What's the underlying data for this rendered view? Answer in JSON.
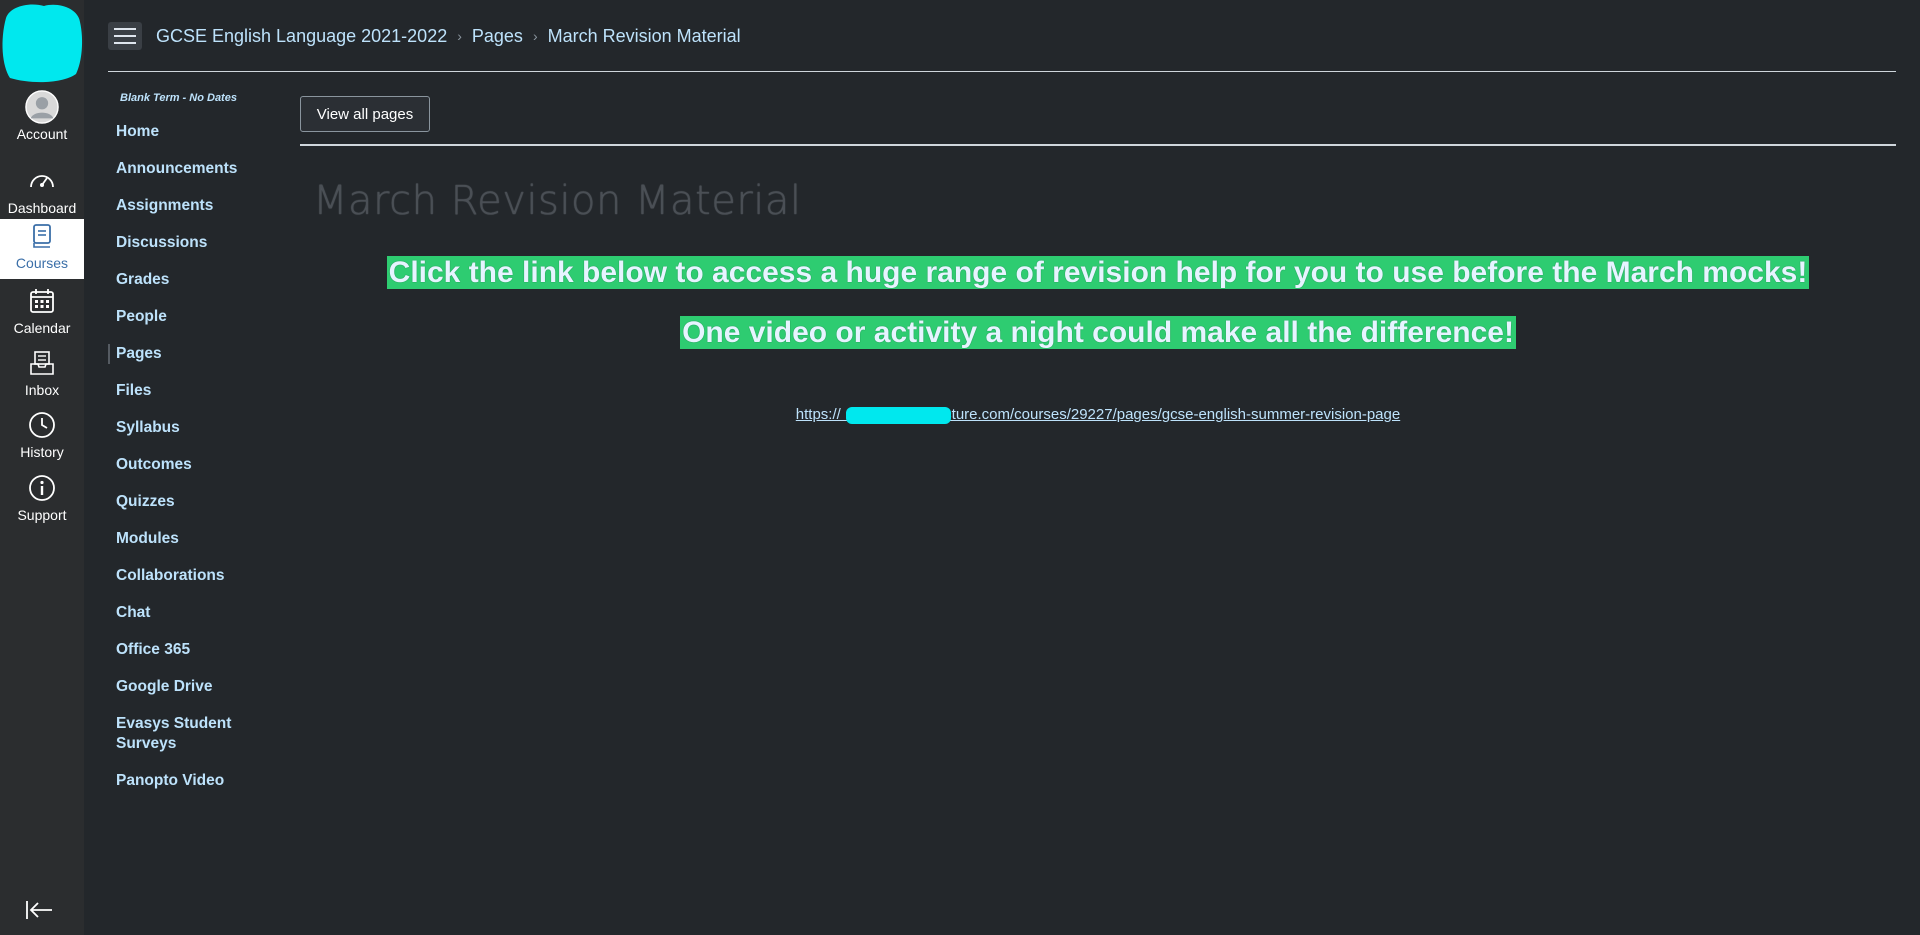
{
  "global_nav": {
    "items": [
      {
        "label": "Account",
        "icon": "account-avatar-icon"
      },
      {
        "label": "Dashboard",
        "icon": "dashboard-gauge-icon"
      },
      {
        "label": "Courses",
        "icon": "courses-book-icon",
        "active": true
      },
      {
        "label": "Calendar",
        "icon": "calendar-icon"
      },
      {
        "label": "Inbox",
        "icon": "inbox-tray-icon"
      },
      {
        "label": "History",
        "icon": "history-clock-icon"
      },
      {
        "label": "Support",
        "icon": "support-info-icon"
      }
    ],
    "accent_active_text": "#3b6fa8",
    "logo_color": "#00e8ee"
  },
  "header": {
    "breadcrumbs": [
      "GCSE English Language 2021-2022",
      "Pages",
      "March Revision Material"
    ]
  },
  "course_nav": {
    "term": "Blank Term - No Dates",
    "items": [
      "Home",
      "Announcements",
      "Assignments",
      "Discussions",
      "Grades",
      "People",
      "Pages",
      "Files",
      "Syllabus",
      "Outcomes",
      "Quizzes",
      "Modules",
      "Collaborations",
      "Chat",
      "Office 365",
      "Google Drive",
      "Evasys Student Surveys",
      "Panopto Video"
    ],
    "active_item": "Pages"
  },
  "main": {
    "view_all_label": "View all pages",
    "page_title": "March Revision Material",
    "line1": "Click the link below to access a huge range of revision help for you to use before the March mocks!",
    "line2": "One video or activity a night could make all the difference!",
    "link_text": "https://                instructure.com/courses/29227/pages/gcse-english-summer-revision-page",
    "highlight_color": "#2ecc71"
  }
}
